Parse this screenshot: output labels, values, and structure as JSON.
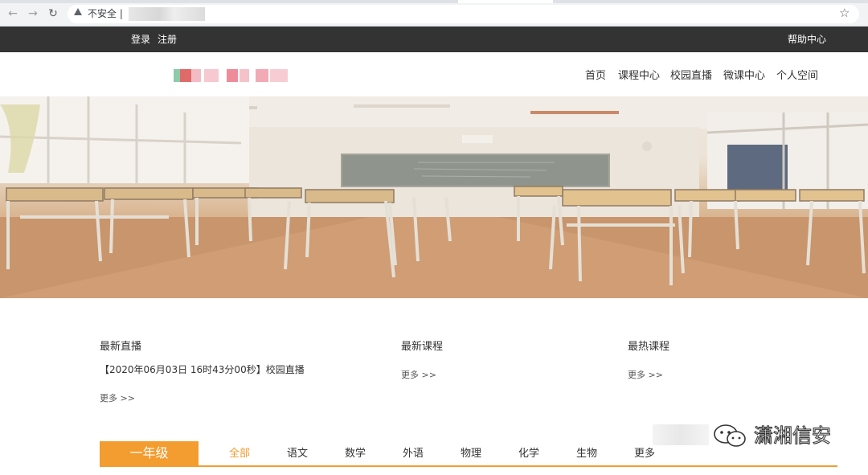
{
  "browser": {
    "security_label": "不安全 |"
  },
  "topbar": {
    "login": "登录",
    "register": "注册",
    "help": "帮助中心"
  },
  "nav": {
    "items": [
      "首页",
      "课程中心",
      "校园直播",
      "微课中心",
      "个人空间"
    ]
  },
  "sections": {
    "live": {
      "title": "最新直播",
      "item": "【2020年06月03日 16时43分00秒】校园直播",
      "more": "更多 >>"
    },
    "new_courses": {
      "title": "最新课程",
      "more": "更多 >>"
    },
    "hot_courses": {
      "title": "最热课程",
      "more": "更多 >>"
    }
  },
  "grade": {
    "label": "一年级",
    "subjects": [
      "全部",
      "语文",
      "数学",
      "外语",
      "物理",
      "化学",
      "生物",
      "更多"
    ],
    "active_index": 0
  },
  "watermark": {
    "text": "潇湘信安"
  },
  "colors": {
    "accent": "#f39c2f",
    "topbar": "#333333"
  }
}
